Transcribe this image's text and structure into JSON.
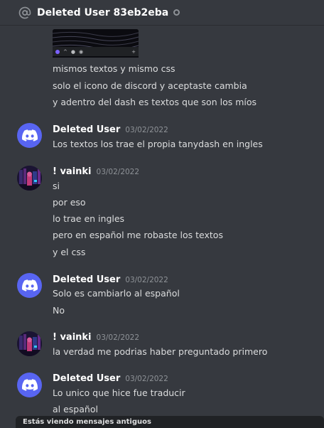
{
  "header": {
    "icon": "at-sign-icon",
    "title": "Deleted User 83eb2eba"
  },
  "attachment": {
    "toolbar_left": "^",
    "toolbar_right": "+"
  },
  "continuation_lines": [
    "mismos textos y mismo css",
    "solo el icono de discord y aceptaste cambia",
    "y adentro del dash es textos que son los míos"
  ],
  "messages": [
    {
      "author": "Deleted User",
      "timestamp": "03/02/2022",
      "lines": [
        "Los textos los trae el propia tanydash en ingles"
      ]
    },
    {
      "author": "! vainki",
      "timestamp": "03/02/2022",
      "lines": [
        "si",
        "por eso",
        "lo trae en ingles",
        "pero en español me robaste los textos",
        "y el css"
      ]
    },
    {
      "author": "Deleted User",
      "timestamp": "03/02/2022",
      "lines": [
        "Solo es cambiarlo al español",
        "No"
      ]
    },
    {
      "author": "! vainki",
      "timestamp": "03/02/2022",
      "lines": [
        "la verdad me podrias haber preguntado primero"
      ]
    },
    {
      "author": "Deleted User",
      "timestamp": "03/02/2022",
      "lines": [
        "Lo unico que hice fue traducir",
        "al español"
      ]
    }
  ],
  "footer": {
    "old_messages_notice": "Estás viendo mensajes antiguos"
  },
  "colors": {
    "background": "#36393f",
    "blurple": "#5865f2",
    "timestamp": "#8e9297",
    "notice_bar": "#202225"
  }
}
